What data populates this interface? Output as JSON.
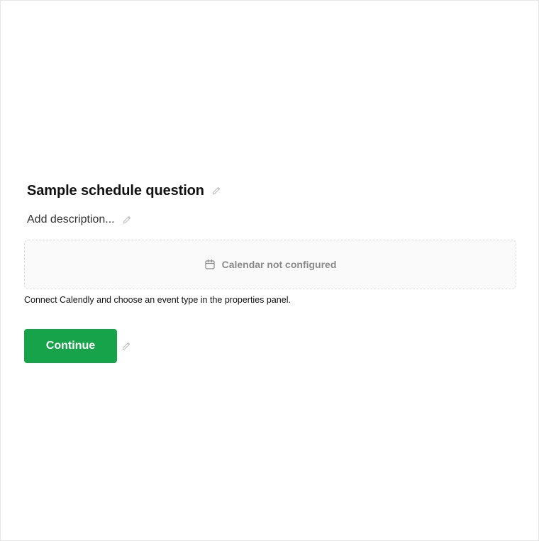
{
  "question": {
    "title": "Sample schedule question",
    "description_placeholder": "Add description..."
  },
  "calendar": {
    "status_text": "Calendar not configured",
    "icon": "calendar-icon"
  },
  "helper": {
    "text": "Connect Calendly and choose an event type in the properties panel."
  },
  "actions": {
    "continue_label": "Continue"
  },
  "icons": {
    "edit": "pencil-icon"
  },
  "colors": {
    "accent": "#17a34a",
    "muted_text": "#8a8a8a",
    "border": "#dcdcdc"
  }
}
